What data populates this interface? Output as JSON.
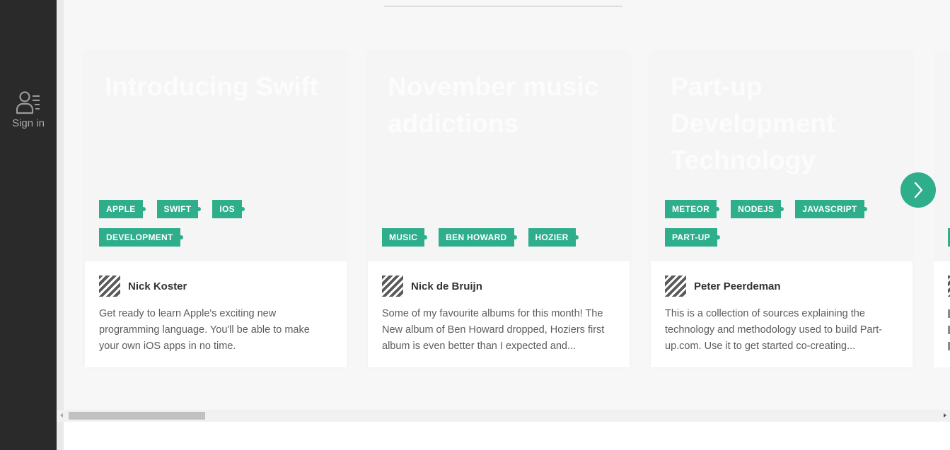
{
  "sidebar": {
    "signin_label": "Sign in",
    "signin_icon": "user-list-icon"
  },
  "cards": [
    {
      "title": "Introducing Swift",
      "tags": [
        "APPLE",
        "SWIFT",
        "IOS",
        "DEVELOPMENT"
      ],
      "author": "Nick Koster",
      "description": "Get ready to learn Apple's exciting new programming language. You'll be able to make your own iOS apps in no time."
    },
    {
      "title": "November music addictions",
      "tags": [
        "MUSIC",
        "BEN HOWARD",
        "HOZIER"
      ],
      "author": "Nick de Bruijn",
      "description": "Some of my favourite albums for this month! The New album of Ben Howard dropped, Hoziers first album is even better than I expected and..."
    },
    {
      "title": "Part-up Development Technology",
      "tags": [
        "METEOR",
        "NODEJS",
        "JAVASCRIPT",
        "PART-UP"
      ],
      "author": "Peter Peerdeman",
      "description": "This is a collection of sources explaining the technology and methodology used to build Part-up.com. Use it to get started co-creating..."
    }
  ],
  "carousel": {
    "next_icon": "chevron-right-icon"
  },
  "colors": {
    "sidebar": "#2a2a2a",
    "accent": "#2fae8c",
    "background": "#f7f7f7",
    "card": "#ffffff"
  }
}
